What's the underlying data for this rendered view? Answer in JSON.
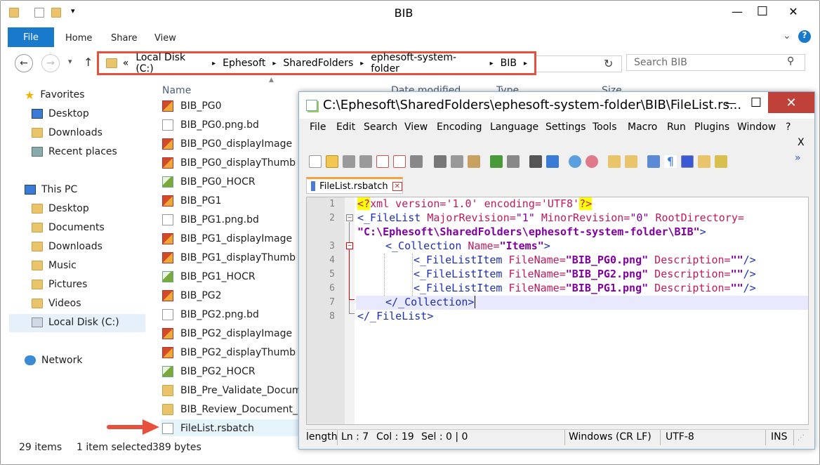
{
  "explorer": {
    "title": "BIB",
    "qat_dropdown": "▾",
    "win_minimize": "—",
    "win_maximize": "☐",
    "win_close": "✕",
    "ribbon": {
      "file": "File",
      "home": "Home",
      "share": "Share",
      "view": "View"
    },
    "nav": {
      "back": "←",
      "forward": "→",
      "recent": "▾",
      "up": "↑"
    },
    "address": {
      "chevron": "«",
      "crumbs": [
        "Local Disk (C:)",
        "Ephesoft",
        "SharedFolders",
        "ephesoft-system-folder",
        "BIB"
      ],
      "sep": "▸",
      "refresh": "↻"
    },
    "search_placeholder": "Search BIB",
    "search_icon": "⚲",
    "nav_pane": {
      "favorites": "Favorites",
      "fav_items": [
        "Desktop",
        "Downloads",
        "Recent places"
      ],
      "this_pc": "This PC",
      "pc_items": [
        "Desktop",
        "Documents",
        "Downloads",
        "Music",
        "Pictures",
        "Videos",
        "Local Disk (C:)"
      ],
      "network": "Network"
    },
    "columns": {
      "name": "Name",
      "date": "Date modified",
      "type": "Type",
      "size": "Size"
    },
    "files": [
      {
        "name": "BIB_PG0",
        "icon": "image-icon"
      },
      {
        "name": "BIB_PG0.png.bd",
        "icon": "document-icon"
      },
      {
        "name": "BIB_PG0_displayImage",
        "icon": "image-icon"
      },
      {
        "name": "BIB_PG0_displayThumb",
        "icon": "image-icon"
      },
      {
        "name": "BIB_PG0_HOCR",
        "icon": "hocr-icon"
      },
      {
        "name": "BIB_PG1",
        "icon": "image-icon"
      },
      {
        "name": "BIB_PG1.png.bd",
        "icon": "document-icon"
      },
      {
        "name": "BIB_PG1_displayImage",
        "icon": "image-icon"
      },
      {
        "name": "BIB_PG1_displayThumb",
        "icon": "image-icon"
      },
      {
        "name": "BIB_PG1_HOCR",
        "icon": "hocr-icon"
      },
      {
        "name": "BIB_PG2",
        "icon": "image-icon"
      },
      {
        "name": "BIB_PG2.png.bd",
        "icon": "document-icon"
      },
      {
        "name": "BIB_PG2_displayImage",
        "icon": "image-icon"
      },
      {
        "name": "BIB_PG2_displayThumb",
        "icon": "image-icon"
      },
      {
        "name": "BIB_PG2_HOCR",
        "icon": "hocr-icon"
      },
      {
        "name": "BIB_Pre_Validate_Docume",
        "icon": "folder-icon"
      },
      {
        "name": "BIB_Review_Document_Bo",
        "icon": "folder-icon"
      },
      {
        "name": "FileList.rsbatch",
        "icon": "document-icon"
      }
    ],
    "status": {
      "count": "29 items",
      "selected": "1 item selected",
      "size": "389 bytes"
    }
  },
  "notepad": {
    "title": "C:\\Ephesoft\\SharedFolders\\ephesoft-system-folder\\BIB\\FileList.rs...",
    "win_minimize": "—",
    "win_maximize": "☐",
    "win_close": "✕",
    "menus": [
      "File",
      "Edit",
      "Search",
      "View",
      "Encoding",
      "Language",
      "Settings",
      "Tools",
      "Macro",
      "Run",
      "Plugins",
      "Window",
      "?"
    ],
    "menu_close": "X",
    "toolbar_overflow": "»",
    "tab_label": "FileList.rsbatch",
    "tab_close": "✕",
    "line_numbers": [
      "1",
      "2",
      "",
      "3",
      "4",
      "5",
      "6",
      "7",
      "8"
    ],
    "code": {
      "l1": {
        "pi_open": "<?",
        "xml": "xml",
        "version_attr": " version=",
        "version_val": "'1.0'",
        "enc_attr": " encoding=",
        "enc_val": "'UTF8'",
        "pi_close": "?>"
      },
      "l2": {
        "tag": "<_FileList",
        "a1": " MajorRevision=",
        "v1": "\"1\"",
        "a2": " MinorRevision=",
        "v2": "\"0\"",
        "a3": " RootDirectory="
      },
      "l2b": {
        "v3": "\"C:\\Ephesoft\\SharedFolders\\ephesoft-system-folder\\BIB\"",
        "close": ">"
      },
      "l3": {
        "tag": "<_Collection",
        "a1": " Name=",
        "v1": "\"Items\"",
        "close": ">"
      },
      "l4": {
        "tag": "<_FileListItem",
        "a1": " FileName=",
        "v1": "\"BIB_PG0.png\"",
        "a2": " Description=",
        "v2": "\"\"",
        "close": "/>"
      },
      "l5": {
        "tag": "<_FileListItem",
        "a1": " FileName=",
        "v1": "\"BIB_PG2.png\"",
        "a2": " Description=",
        "v2": "\"\"",
        "close": "/>"
      },
      "l6": {
        "tag": "<_FileListItem",
        "a1": " FileName=",
        "v1": "\"BIB_PG1.png\"",
        "a2": " Description=",
        "v2": "\"\"",
        "close": "/>"
      },
      "l7": {
        "tag": "</_Collection>"
      },
      "l8": {
        "tag": "</_FileList>"
      }
    },
    "status": {
      "length": "length",
      "ln": "Ln : 7",
      "col": "Col : 19",
      "sel": "Sel : 0 | 0",
      "eol": "Windows (CR LF)",
      "enc": "UTF-8",
      "ins": "INS"
    }
  },
  "colors": {
    "accent": "#1979ca",
    "highlight": "#e8503e",
    "npp_close": "#c0403a",
    "tab_accent": "#f9a03f"
  }
}
